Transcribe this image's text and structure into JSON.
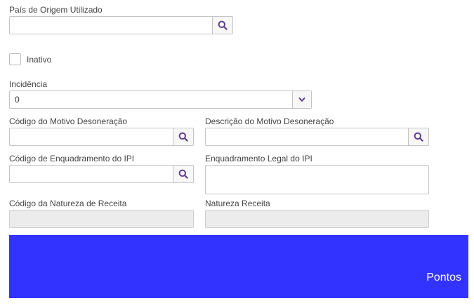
{
  "form": {
    "pais_origem": {
      "label": "País de Origem Utilizado",
      "value": ""
    },
    "inativo": {
      "label": "Inativo",
      "checked": false
    },
    "incidencia": {
      "label": "Incidência",
      "value": "0"
    },
    "codigo_motivo_desoneracao": {
      "label": "Código do Motivo Desoneração",
      "value": ""
    },
    "descricao_motivo_desoneracao": {
      "label": "Descrição do Motivo Desoneração",
      "value": ""
    },
    "codigo_enquadramento_ipi": {
      "label": "Código de Enquadramento do IPI",
      "value": ""
    },
    "enquadramento_legal_ipi": {
      "label": "Enquadramento Legal do IPI",
      "value": ""
    },
    "codigo_natureza_receita": {
      "label": "Código da Natureza de Receita",
      "value": ""
    },
    "natureza_receita": {
      "label": "Natureza Receita",
      "value": ""
    }
  },
  "banner": {
    "text": "Pontos",
    "color": "#3333ff"
  },
  "colors": {
    "icon": "#5c3d8f",
    "border": "#c4c4c4",
    "readonly_bg": "#ececec"
  },
  "icons": {
    "search": "search-icon",
    "dropdown": "chevron-down-icon"
  }
}
